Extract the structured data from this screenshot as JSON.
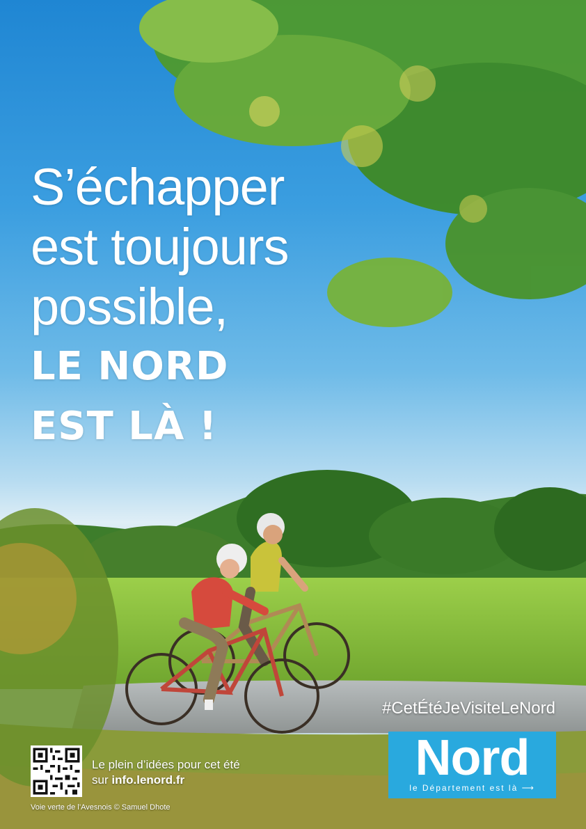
{
  "headline": {
    "line1": "S’échapper",
    "line2": "est toujours",
    "line3": "possible,",
    "line4": "LE NORD",
    "line5": "EST LÀ !"
  },
  "hashtag": "#CetÉtéJeVisiteLeNord",
  "logo": {
    "word": "Nord",
    "tagline": "le Département est là"
  },
  "info": {
    "line1": "Le plein d’idées pour cet été",
    "prefix": "sur ",
    "url": "info.lenord.fr"
  },
  "credit": "Voie verte de l’Avesnois © Samuel Dhote",
  "colors": {
    "sky": "#2a8fd8",
    "brand_blue": "#29a9de",
    "grass": "#7fb43a",
    "foliage": "#3f8f2a"
  }
}
